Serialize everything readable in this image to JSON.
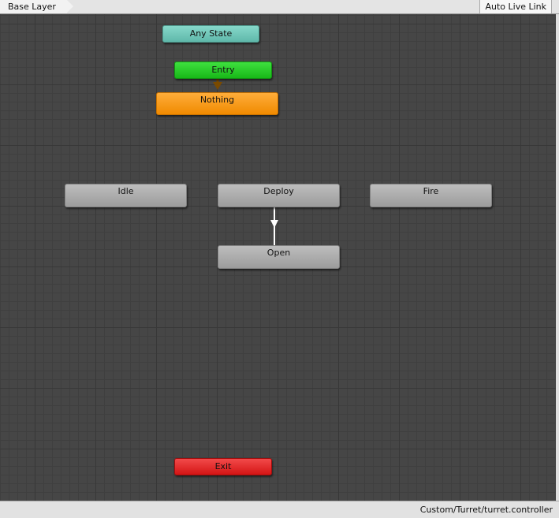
{
  "toolbar": {
    "breadcrumb": "Base Layer",
    "live_link": "Auto Live Link"
  },
  "states": {
    "any_state": "Any State",
    "entry": "Entry",
    "nothing": "Nothing",
    "idle": "Idle",
    "deploy": "Deploy",
    "fire": "Fire",
    "open": "Open",
    "exit": "Exit"
  },
  "transitions": [
    {
      "from": "Entry",
      "to": "Nothing"
    },
    {
      "from": "Deploy",
      "to": "Open"
    }
  ],
  "status_bar": {
    "path": "Custom/Turret/turret.controller"
  },
  "colors": {
    "canvas": "#464646",
    "any_state": "#6fc8ba",
    "entry": "#22c422",
    "default_state": "#f5940f",
    "exit": "#e02222",
    "state": "#acacac"
  }
}
